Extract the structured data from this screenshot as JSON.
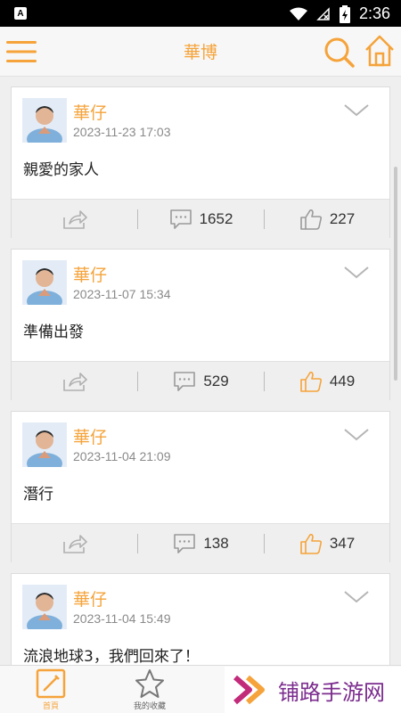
{
  "status_bar": {
    "time": "2:36",
    "app_icon_letter": "A"
  },
  "app_bar": {
    "title": "華博"
  },
  "posts": [
    {
      "author": "華仔",
      "date": "2023-11-23 17:03",
      "content": "親愛的家人",
      "comments": "1652",
      "likes": "227",
      "liked": false
    },
    {
      "author": "華仔",
      "date": "2023-11-07 15:34",
      "content": "準備出發",
      "comments": "529",
      "likes": "449",
      "liked": true
    },
    {
      "author": "華仔",
      "date": "2023-11-04 21:09",
      "content": "潛行",
      "comments": "138",
      "likes": "347",
      "liked": true
    },
    {
      "author": "華仔",
      "date": "2023-11-04 15:49",
      "content": "流浪地球3，我們回來了！",
      "comments": "",
      "likes": "",
      "liked": false
    }
  ],
  "bottom_nav": {
    "home_label": "首頁",
    "favorites_label": "我的收藏"
  },
  "watermark": {
    "text": "铺路手游网"
  },
  "colors": {
    "accent": "#f5a33a",
    "like_inactive": "#9a9a9a",
    "like_active": "#f5a33a"
  },
  "icons": [
    "menu-icon",
    "search-icon",
    "home-icon",
    "chevron-down-icon",
    "share-icon",
    "comment-icon",
    "like-icon",
    "star-icon",
    "edit-icon"
  ]
}
